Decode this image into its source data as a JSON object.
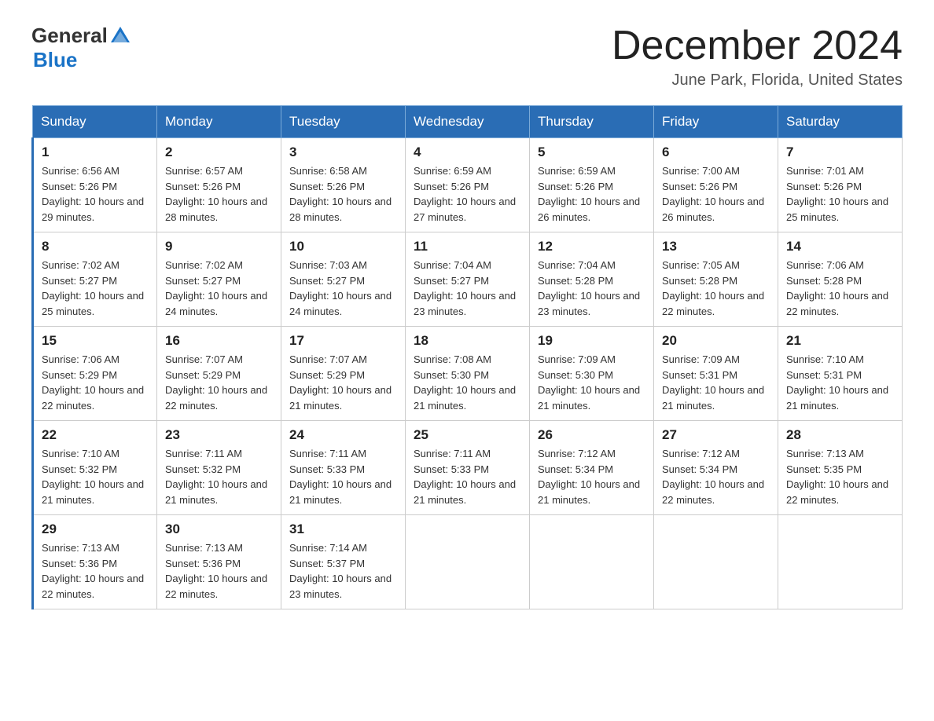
{
  "header": {
    "logo_general": "General",
    "logo_blue": "Blue",
    "month_title": "December 2024",
    "location": "June Park, Florida, United States"
  },
  "days_of_week": [
    "Sunday",
    "Monday",
    "Tuesday",
    "Wednesday",
    "Thursday",
    "Friday",
    "Saturday"
  ],
  "weeks": [
    [
      {
        "day": "1",
        "sunrise": "6:56 AM",
        "sunset": "5:26 PM",
        "daylight": "10 hours and 29 minutes."
      },
      {
        "day": "2",
        "sunrise": "6:57 AM",
        "sunset": "5:26 PM",
        "daylight": "10 hours and 28 minutes."
      },
      {
        "day": "3",
        "sunrise": "6:58 AM",
        "sunset": "5:26 PM",
        "daylight": "10 hours and 28 minutes."
      },
      {
        "day": "4",
        "sunrise": "6:59 AM",
        "sunset": "5:26 PM",
        "daylight": "10 hours and 27 minutes."
      },
      {
        "day": "5",
        "sunrise": "6:59 AM",
        "sunset": "5:26 PM",
        "daylight": "10 hours and 26 minutes."
      },
      {
        "day": "6",
        "sunrise": "7:00 AM",
        "sunset": "5:26 PM",
        "daylight": "10 hours and 26 minutes."
      },
      {
        "day": "7",
        "sunrise": "7:01 AM",
        "sunset": "5:26 PM",
        "daylight": "10 hours and 25 minutes."
      }
    ],
    [
      {
        "day": "8",
        "sunrise": "7:02 AM",
        "sunset": "5:27 PM",
        "daylight": "10 hours and 25 minutes."
      },
      {
        "day": "9",
        "sunrise": "7:02 AM",
        "sunset": "5:27 PM",
        "daylight": "10 hours and 24 minutes."
      },
      {
        "day": "10",
        "sunrise": "7:03 AM",
        "sunset": "5:27 PM",
        "daylight": "10 hours and 24 minutes."
      },
      {
        "day": "11",
        "sunrise": "7:04 AM",
        "sunset": "5:27 PM",
        "daylight": "10 hours and 23 minutes."
      },
      {
        "day": "12",
        "sunrise": "7:04 AM",
        "sunset": "5:28 PM",
        "daylight": "10 hours and 23 minutes."
      },
      {
        "day": "13",
        "sunrise": "7:05 AM",
        "sunset": "5:28 PM",
        "daylight": "10 hours and 22 minutes."
      },
      {
        "day": "14",
        "sunrise": "7:06 AM",
        "sunset": "5:28 PM",
        "daylight": "10 hours and 22 minutes."
      }
    ],
    [
      {
        "day": "15",
        "sunrise": "7:06 AM",
        "sunset": "5:29 PM",
        "daylight": "10 hours and 22 minutes."
      },
      {
        "day": "16",
        "sunrise": "7:07 AM",
        "sunset": "5:29 PM",
        "daylight": "10 hours and 22 minutes."
      },
      {
        "day": "17",
        "sunrise": "7:07 AM",
        "sunset": "5:29 PM",
        "daylight": "10 hours and 21 minutes."
      },
      {
        "day": "18",
        "sunrise": "7:08 AM",
        "sunset": "5:30 PM",
        "daylight": "10 hours and 21 minutes."
      },
      {
        "day": "19",
        "sunrise": "7:09 AM",
        "sunset": "5:30 PM",
        "daylight": "10 hours and 21 minutes."
      },
      {
        "day": "20",
        "sunrise": "7:09 AM",
        "sunset": "5:31 PM",
        "daylight": "10 hours and 21 minutes."
      },
      {
        "day": "21",
        "sunrise": "7:10 AM",
        "sunset": "5:31 PM",
        "daylight": "10 hours and 21 minutes."
      }
    ],
    [
      {
        "day": "22",
        "sunrise": "7:10 AM",
        "sunset": "5:32 PM",
        "daylight": "10 hours and 21 minutes."
      },
      {
        "day": "23",
        "sunrise": "7:11 AM",
        "sunset": "5:32 PM",
        "daylight": "10 hours and 21 minutes."
      },
      {
        "day": "24",
        "sunrise": "7:11 AM",
        "sunset": "5:33 PM",
        "daylight": "10 hours and 21 minutes."
      },
      {
        "day": "25",
        "sunrise": "7:11 AM",
        "sunset": "5:33 PM",
        "daylight": "10 hours and 21 minutes."
      },
      {
        "day": "26",
        "sunrise": "7:12 AM",
        "sunset": "5:34 PM",
        "daylight": "10 hours and 21 minutes."
      },
      {
        "day": "27",
        "sunrise": "7:12 AM",
        "sunset": "5:34 PM",
        "daylight": "10 hours and 22 minutes."
      },
      {
        "day": "28",
        "sunrise": "7:13 AM",
        "sunset": "5:35 PM",
        "daylight": "10 hours and 22 minutes."
      }
    ],
    [
      {
        "day": "29",
        "sunrise": "7:13 AM",
        "sunset": "5:36 PM",
        "daylight": "10 hours and 22 minutes."
      },
      {
        "day": "30",
        "sunrise": "7:13 AM",
        "sunset": "5:36 PM",
        "daylight": "10 hours and 22 minutes."
      },
      {
        "day": "31",
        "sunrise": "7:14 AM",
        "sunset": "5:37 PM",
        "daylight": "10 hours and 23 minutes."
      },
      null,
      null,
      null,
      null
    ]
  ]
}
